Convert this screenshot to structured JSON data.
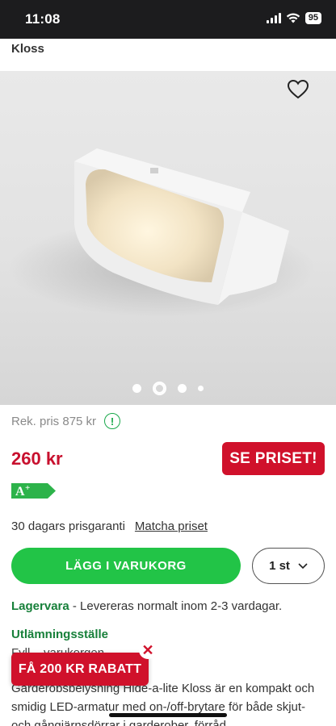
{
  "status_bar": {
    "time": "11:08",
    "battery": "95"
  },
  "header": {
    "title": "Kloss"
  },
  "gallery": {
    "active_index": 1,
    "dot_count": 4
  },
  "pricing": {
    "rek_price": "Rek. pris 875 kr",
    "info_symbol": "!",
    "price": "260 kr",
    "see_price_button": "SE PRISET!",
    "energy_class": "A",
    "energy_class_plus": "+"
  },
  "guarantee": {
    "text": "30 dagars prisgaranti",
    "link": "Matcha priset"
  },
  "cart": {
    "add_label": "LÄGG I VARUKORG",
    "quantity": "1 st"
  },
  "stock": {
    "label": "Lagervara",
    "text": "- Levereras normalt inom 2-3 vardagar."
  },
  "pickup": {
    "title": "Utlämningsställe",
    "text": "Fyll... varukorgen."
  },
  "description": {
    "text": "Garderobsbelysning Hide-a-lite Kloss är en kompakt och smidig LED-armatur med on-/off-brytare för både skjut- och gångjärnsdörrar i garderober, förråd"
  },
  "promo": {
    "label": "FÅ 200 KR RABATT",
    "close_symbol": "✕"
  },
  "colors": {
    "brand_red": "#d0112b",
    "brand_green": "#22c447",
    "text_green": "#17803a"
  }
}
